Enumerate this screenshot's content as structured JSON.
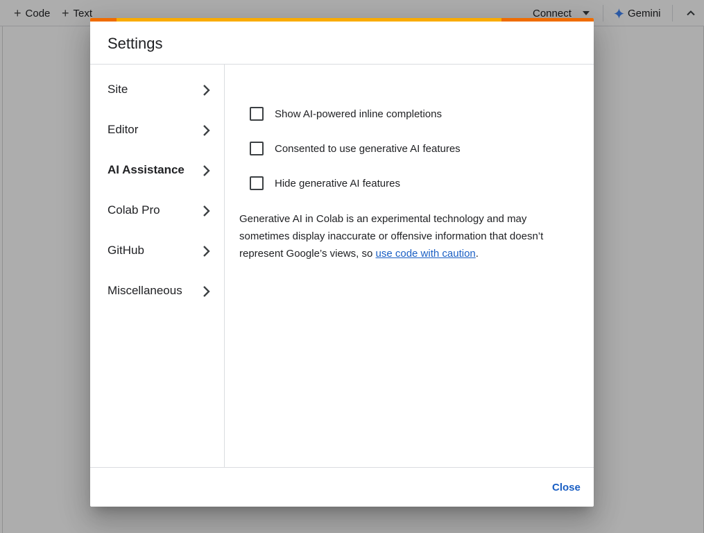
{
  "toolbar": {
    "add_code": "Code",
    "add_text": "Text",
    "connect": "Connect",
    "gemini": "Gemini"
  },
  "dialog": {
    "title": "Settings",
    "nav": [
      {
        "label": "Site",
        "active": false
      },
      {
        "label": "Editor",
        "active": false
      },
      {
        "label": "AI Assistance",
        "active": true
      },
      {
        "label": "Colab Pro",
        "active": false
      },
      {
        "label": "GitHub",
        "active": false
      },
      {
        "label": "Miscellaneous",
        "active": false
      }
    ],
    "options": [
      {
        "label": "Show AI-powered inline completions",
        "checked": false
      },
      {
        "label": "Consented to use generative AI features",
        "checked": false
      },
      {
        "label": "Hide generative AI features",
        "checked": false
      }
    ],
    "disclaimer": {
      "text": "Generative AI in Colab is an experimental technology and may sometimes display inaccurate or offensive information that doesn’t represent Google’s views, so",
      "link": "use code with caution",
      "end": "."
    },
    "close_label": "Close"
  },
  "colors": {
    "accent_link": "#1a5fc4",
    "progress_main": "#f9ab00",
    "progress_end": "#ef6c00",
    "gemini_star": "#4285f4"
  }
}
